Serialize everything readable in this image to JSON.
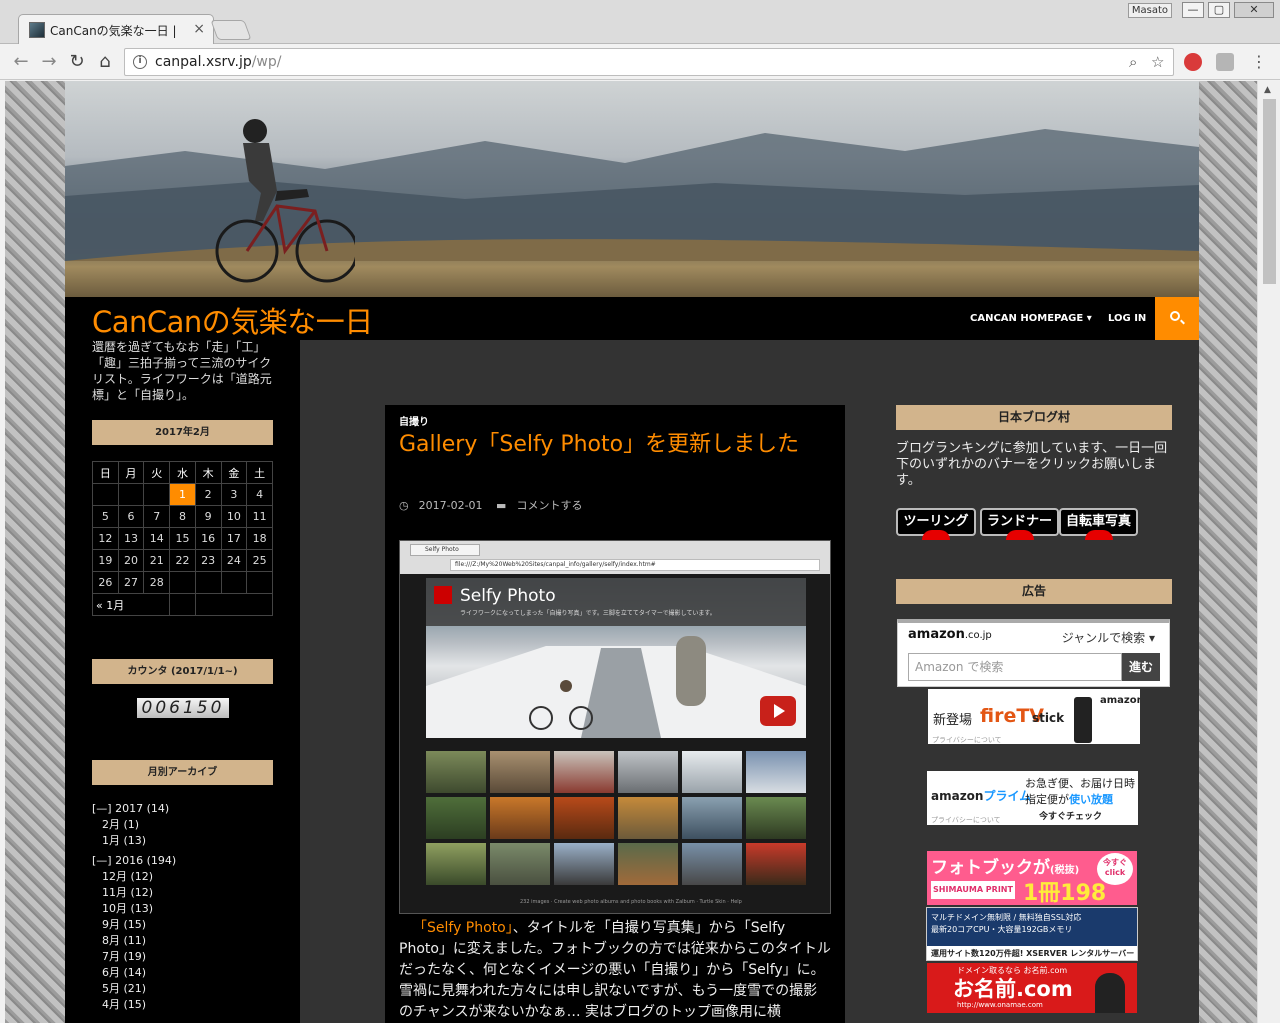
{
  "browser": {
    "tab_title": "CanCanの気楽な一日",
    "tab_title_shown": "CanCanの気楽な一日 |",
    "profile_name": "Masato",
    "url_host": "canpal.xsrv.jp",
    "url_path": "/wp/"
  },
  "site": {
    "title": "CanCanの気楽な一日",
    "tagline": "還暦を過ぎてもなお「走」「工」「趣」三拍子揃って三流のサイクリスト。ライフワークは「道路元標」と「自撮り」。",
    "nav": [
      "CANCAN HOMEPAGE",
      "LOG IN"
    ],
    "accent_color": "#ff8c00",
    "widget_color": "#d2b48c"
  },
  "sidebar_left": {
    "calendar": {
      "title": "2017年2月",
      "weekdays": [
        "日",
        "月",
        "火",
        "水",
        "木",
        "金",
        "土"
      ],
      "weeks": [
        [
          "",
          "",
          "",
          "1",
          "2",
          "3",
          "4"
        ],
        [
          "5",
          "6",
          "7",
          "8",
          "9",
          "10",
          "11"
        ],
        [
          "12",
          "13",
          "14",
          "15",
          "16",
          "17",
          "18"
        ],
        [
          "19",
          "20",
          "21",
          "22",
          "23",
          "24",
          "25"
        ],
        [
          "26",
          "27",
          "28",
          "",
          "",
          "",
          ""
        ]
      ],
      "today": "1",
      "prev_link": "« 1月"
    },
    "counter": {
      "title": "カウンタ (2017/1/1~)",
      "value": "006150"
    },
    "archive": {
      "title": "月別アーカイブ",
      "years": [
        {
          "label": "[—] 2017 (14)",
          "months": [
            "2月 (1)",
            "1月 (13)"
          ]
        },
        {
          "label": "[—] 2016 (194)",
          "months": [
            "12月 (12)",
            "11月 (12)",
            "10月 (13)",
            "9月 (15)",
            "8月 (11)",
            "7月 (19)",
            "6月 (14)",
            "5月 (21)",
            "4月 (15)"
          ]
        }
      ]
    }
  },
  "post": {
    "category": "自撮り",
    "title": "Gallery「Selfy Photo」を更新しました",
    "date": "2017-02-01",
    "comment_link": "コメントする",
    "screenshot": {
      "tab": "Selfy Photo",
      "url": "file:///Z:/My%20Web%20Sites/canpal_info/gallery/selfy/index.htm#",
      "title": "Selfy Photo",
      "subtitle": "ライフワークになってしまった「自撮り写真」です。三脚を立ててタイマーで撮影しています。",
      "footer": "232 images · Create web photo albums and photo books with Zalbum · Turtle Skin · Help"
    },
    "body_link": "「Selfy Photo」",
    "body": "、タイトルを「自撮り写真集」から「Selfy Photo」に変えました。フォトブックの方では従来からこのタイトルだったなく、何となくイメージの悪い「自撮り」から「Selfy」に。雪禍に見舞われた方々には申し訳ないですが、もう一度雪での撮影のチャンスが来ないかなぁ… 実はブログのトップ画像用に横"
  },
  "sidebar_right": {
    "blog_village": {
      "title": "日本ブログ村",
      "text": "ブログランキングに参加しています、一日一回下のいずれかのバナーをクリックお願いします。",
      "buttons": [
        "ツーリング",
        "ランドナー",
        "自転車写真"
      ]
    },
    "ads": {
      "title": "広告",
      "amazon_logo": "amazon",
      "amazon_domain": ".co.jp",
      "amazon_genre": "ジャンルで検索",
      "amazon_placeholder": "Amazon で検索",
      "amazon_go": "進む",
      "fire_new": "新登場",
      "fire_name": "fireTV",
      "fire_stick": "stick",
      "fire_brand": "amazon",
      "privacy": "プライバシーについて",
      "prime_logo": "amazon",
      "prime_word": "プライム",
      "prime_line1": "お急ぎ便、お届け日時",
      "prime_line2a": "指定便が",
      "prime_line2b": "使い放題",
      "prime_check": "今すぐチェック",
      "photobook_main": "フォトブック",
      "photobook_ga": "が",
      "photobook_tax": "(税抜)",
      "photobook_price": "1冊198円〜",
      "photobook_brand": "SHIMAUMA PRINT",
      "photobook_badge": "今すぐ click",
      "xserver_lines": [
        "マルチドメイン無制限 / 無料独自SSL対応",
        "最新20コアCPU・大容量192GBメモリ"
      ],
      "xserver_bottom": "運用サイト数120万件超! XSERVER レンタルサーバー",
      "onamae_top": "ドメイン取るなら お名前.com",
      "onamae_main": "お名前.com",
      "onamae_url": "http://www.onamae.com"
    }
  }
}
